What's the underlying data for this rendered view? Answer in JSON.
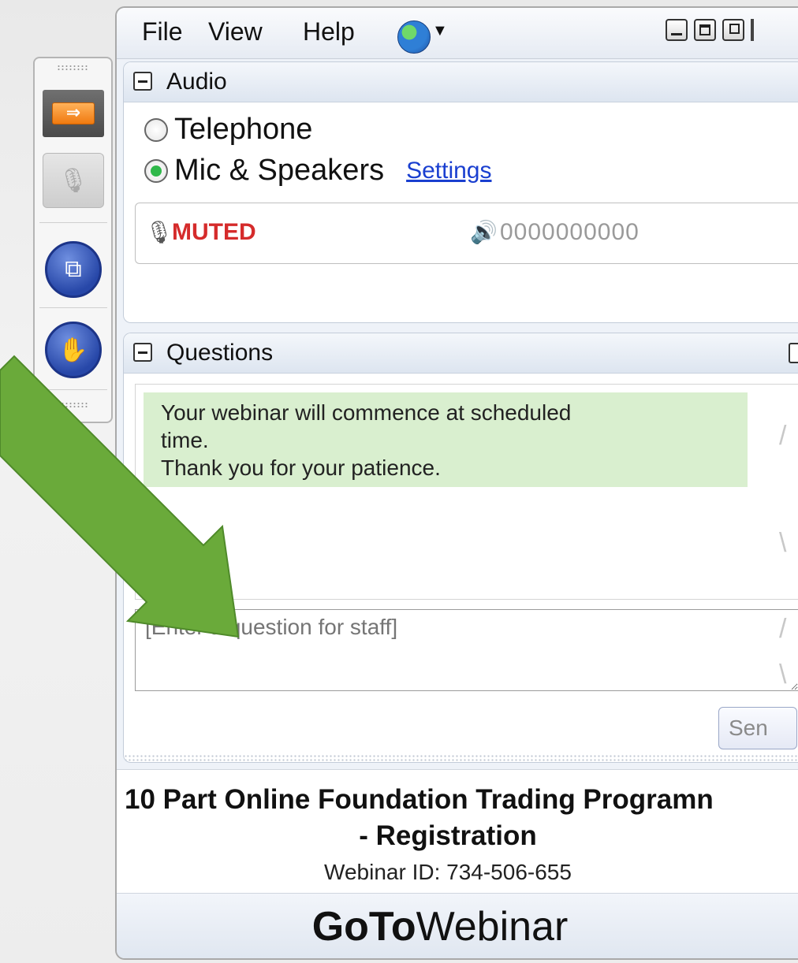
{
  "menu": {
    "file": "File",
    "view": "View",
    "help": "Help"
  },
  "audio": {
    "title": "Audio",
    "telephone_label": "Telephone",
    "mic_label": "Mic & Speakers",
    "selected": "Mic & Speakers",
    "settings_link": "Settings",
    "mute_status": "MUTED",
    "level_readout": "0000000000"
  },
  "questions": {
    "title": "Questions",
    "message_lines": [
      "Your webinar will commence at scheduled",
      "time.",
      "Thank you for your patience."
    ],
    "input_placeholder": "[Enter a question for staff]",
    "send_label": "Sen"
  },
  "webinar": {
    "title": "10 Part Online Foundation Trading  Programn",
    "subtitle": "- Registration",
    "id_line": "Webinar ID: 734-506-655"
  },
  "brand": {
    "bold": "GoTo",
    "light": "Webinar"
  },
  "colors": {
    "muted": "#d52b2b",
    "radio_on": "#2fb84a",
    "link": "#1a3fd0",
    "message_bg": "#d9efcf",
    "arrow": "#6aaa3a"
  },
  "icons": {
    "toolbar": [
      "arrow-right-icon",
      "microphone-icon",
      "windows-icon",
      "raise-hand-icon"
    ],
    "menu": [
      "globe-icon",
      "minimize-icon",
      "maximize-icon",
      "restore-icon"
    ],
    "audio": [
      "microphone-muted-icon",
      "speaker-icon"
    ]
  }
}
